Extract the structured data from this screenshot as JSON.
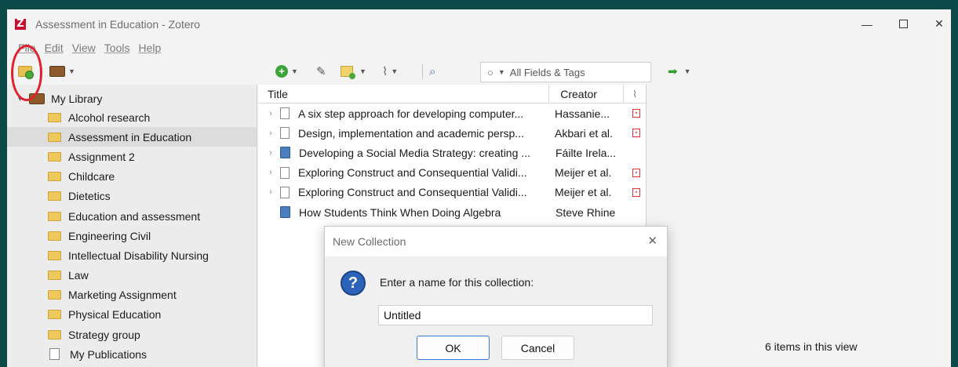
{
  "window": {
    "title": "Assessment in Education - Zotero",
    "logo_letter": "Z"
  },
  "menu": [
    "File",
    "Edit",
    "View",
    "Tools",
    "Help"
  ],
  "search": {
    "placeholder": "All Fields & Tags"
  },
  "library": {
    "label": "My Library",
    "collections": [
      "Alcohol research",
      "Assessment in Education",
      "Assignment 2",
      "Childcare",
      "Dietetics",
      "Education and assessment",
      "Engineering Civil",
      "Intellectual Disability Nursing",
      "Law",
      "Marketing Assignment",
      "Physical Education",
      "Strategy group"
    ],
    "selected_index": 1,
    "publications": "My Publications"
  },
  "items": {
    "columns": {
      "title": "Title",
      "creator": "Creator"
    },
    "rows": [
      {
        "title": "A six step approach for developing computer...",
        "creator": "Hassanie...",
        "type": "document",
        "pdf": true,
        "expandable": true
      },
      {
        "title": "Design, implementation and academic persp...",
        "creator": "Akbari et al.",
        "type": "document",
        "pdf": true,
        "expandable": true
      },
      {
        "title": "Developing a Social Media Strategy: creating ...",
        "creator": "Fáilte Irela...",
        "type": "book",
        "pdf": false,
        "expandable": true
      },
      {
        "title": "Exploring Construct and Consequential Validi...",
        "creator": "Meijer et al.",
        "type": "document",
        "pdf": true,
        "expandable": true
      },
      {
        "title": "Exploring Construct and Consequential Validi...",
        "creator": "Meijer et al.",
        "type": "document",
        "pdf": true,
        "expandable": true
      },
      {
        "title": "How Students Think When Doing Algebra",
        "creator": "Steve Rhine",
        "type": "book",
        "pdf": false,
        "expandable": false
      }
    ]
  },
  "detail": {
    "count_text": "6 items in this view"
  },
  "dialog": {
    "title": "New Collection",
    "prompt": "Enter a name for this collection:",
    "value": "Untitled",
    "ok": "OK",
    "cancel": "Cancel"
  }
}
